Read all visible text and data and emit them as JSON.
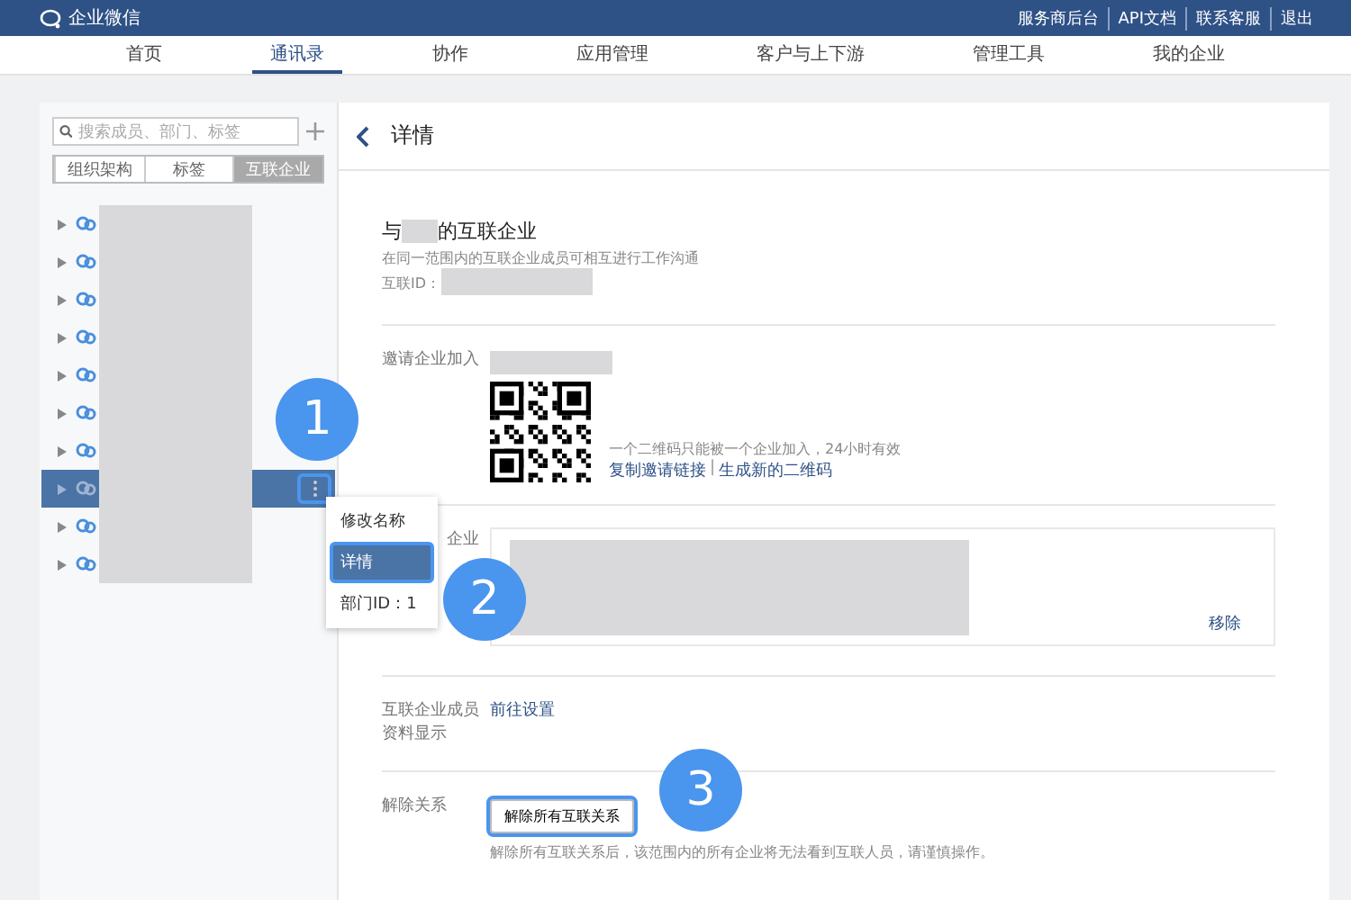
{
  "topbar": {
    "brand": "企业微信",
    "links": [
      "服务商后台",
      "API文档",
      "联系客服",
      "退出"
    ]
  },
  "nav": [
    {
      "label": "首页",
      "selected": false
    },
    {
      "label": "通讯录",
      "selected": true
    },
    {
      "label": "协作",
      "selected": false
    },
    {
      "label": "应用管理",
      "selected": false
    },
    {
      "label": "客户与上下游",
      "selected": false
    },
    {
      "label": "管理工具",
      "selected": false
    },
    {
      "label": "我的企业",
      "selected": false
    }
  ],
  "sidebar": {
    "search": {
      "placeholder": "搜索成员、部门、标签"
    },
    "tabs": [
      {
        "label": "组织架构",
        "selected": false
      },
      {
        "label": "标签",
        "selected": false
      },
      {
        "label": "互联企业",
        "selected": true
      }
    ],
    "tree": [
      {
        "selected": false
      },
      {
        "selected": false
      },
      {
        "selected": false
      },
      {
        "selected": false
      },
      {
        "selected": false
      },
      {
        "selected": false
      },
      {
        "selected": false
      },
      {
        "selected": true
      },
      {
        "selected": false
      },
      {
        "selected": false
      }
    ]
  },
  "context_menu": [
    {
      "label": "修改名称",
      "selected": false
    },
    {
      "label": "详情",
      "selected": true
    },
    {
      "label": "部门ID：1",
      "selected": false
    }
  ],
  "detail": {
    "title": "详情",
    "heading_prefix": "与",
    "heading_suffix": "的互联企业",
    "subtitle": "在同一范围内的互联企业成员可相互进行工作沟通",
    "id_label": "互联ID：",
    "invite": {
      "label": "邀请企业加入",
      "note": "一个二维码只能被一个企业加入，24小时有效",
      "links": [
        "复制邀请链接",
        "生成新的二维码"
      ],
      "separator": "|"
    },
    "partners": {
      "label": "企业",
      "remove": "移除"
    },
    "member_display": {
      "label": "互联企业成员资料显示",
      "link": "前往设置"
    },
    "unbind": {
      "label": "解除关系",
      "button": "解除所有互联关系",
      "note": "解除所有互联关系后，该范围内的所有企业将无法看到互联人员，请谨慎操作。"
    }
  },
  "callouts": [
    "1",
    "2",
    "3"
  ]
}
